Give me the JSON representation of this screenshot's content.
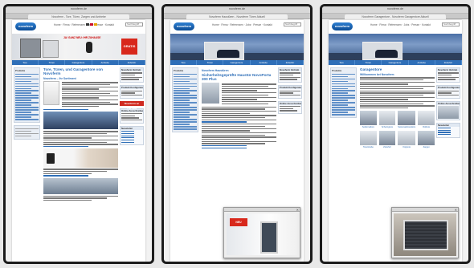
{
  "panels": [
    {
      "address": "novoferm.de",
      "tab_title": "Novoferm - Tore, Türen, Zargen und Antriebe",
      "page": {
        "heading": "Tore, Türen, und Garagentore von Novoferm",
        "subheading": "Novoferm – Ihr Sortiment"
      },
      "banner_text": "JA! GANZ NEU: IHR ZUHAUSE",
      "banner_promo": "GRATIS"
    },
    {
      "address": "novoferm.de",
      "tab_title": "Novoferm Haustüren - Novoferm Türen Aktuell",
      "page": {
        "heading": "Sicherheitsgeprüfte Haustür NovoPorta 300 Plus",
        "subheading": "Novoferm Haustüren"
      },
      "popup_label": "NEU"
    },
    {
      "address": "novoferm.de",
      "tab_title": "Novoferm Garagentore - Novoferm Garagentore Aktuell",
      "page": {
        "heading": "Garagentore",
        "subheading": "Willkommen bei Novoferm"
      },
      "products": [
        {
          "label": "Sektionaltore"
        },
        {
          "label": "Schwingtore"
        },
        {
          "label": "Seitensektionaltore"
        },
        {
          "label": "Rolltore"
        },
        {
          "label": "Torantriebe"
        },
        {
          "label": "Zubehör"
        },
        {
          "label": "Kipptore"
        },
        {
          "label": "Zargen"
        }
      ]
    }
  ],
  "site": {
    "logo_text": "novoferm",
    "topnav": "Home · Firma · Referenzen · Jobs · Presse · Kontakt",
    "search_placeholder": "Suchbegriff",
    "nav_items": [
      "Tore",
      "Türen",
      "Garagentore",
      "Antriebe",
      "Zubehör"
    ],
    "left_box_title": "Produkte",
    "right_box_titles": [
      "Novoferm Vertrieb",
      "Produkt Konfigurator",
      "Online Ausschreibung",
      "Newsletter"
    ],
    "youtube_label": "Novoferm on YouTube"
  },
  "colors": {
    "brand": "#2f6fb8",
    "youtube": "#cf2a20",
    "promo": "#d8281c"
  }
}
